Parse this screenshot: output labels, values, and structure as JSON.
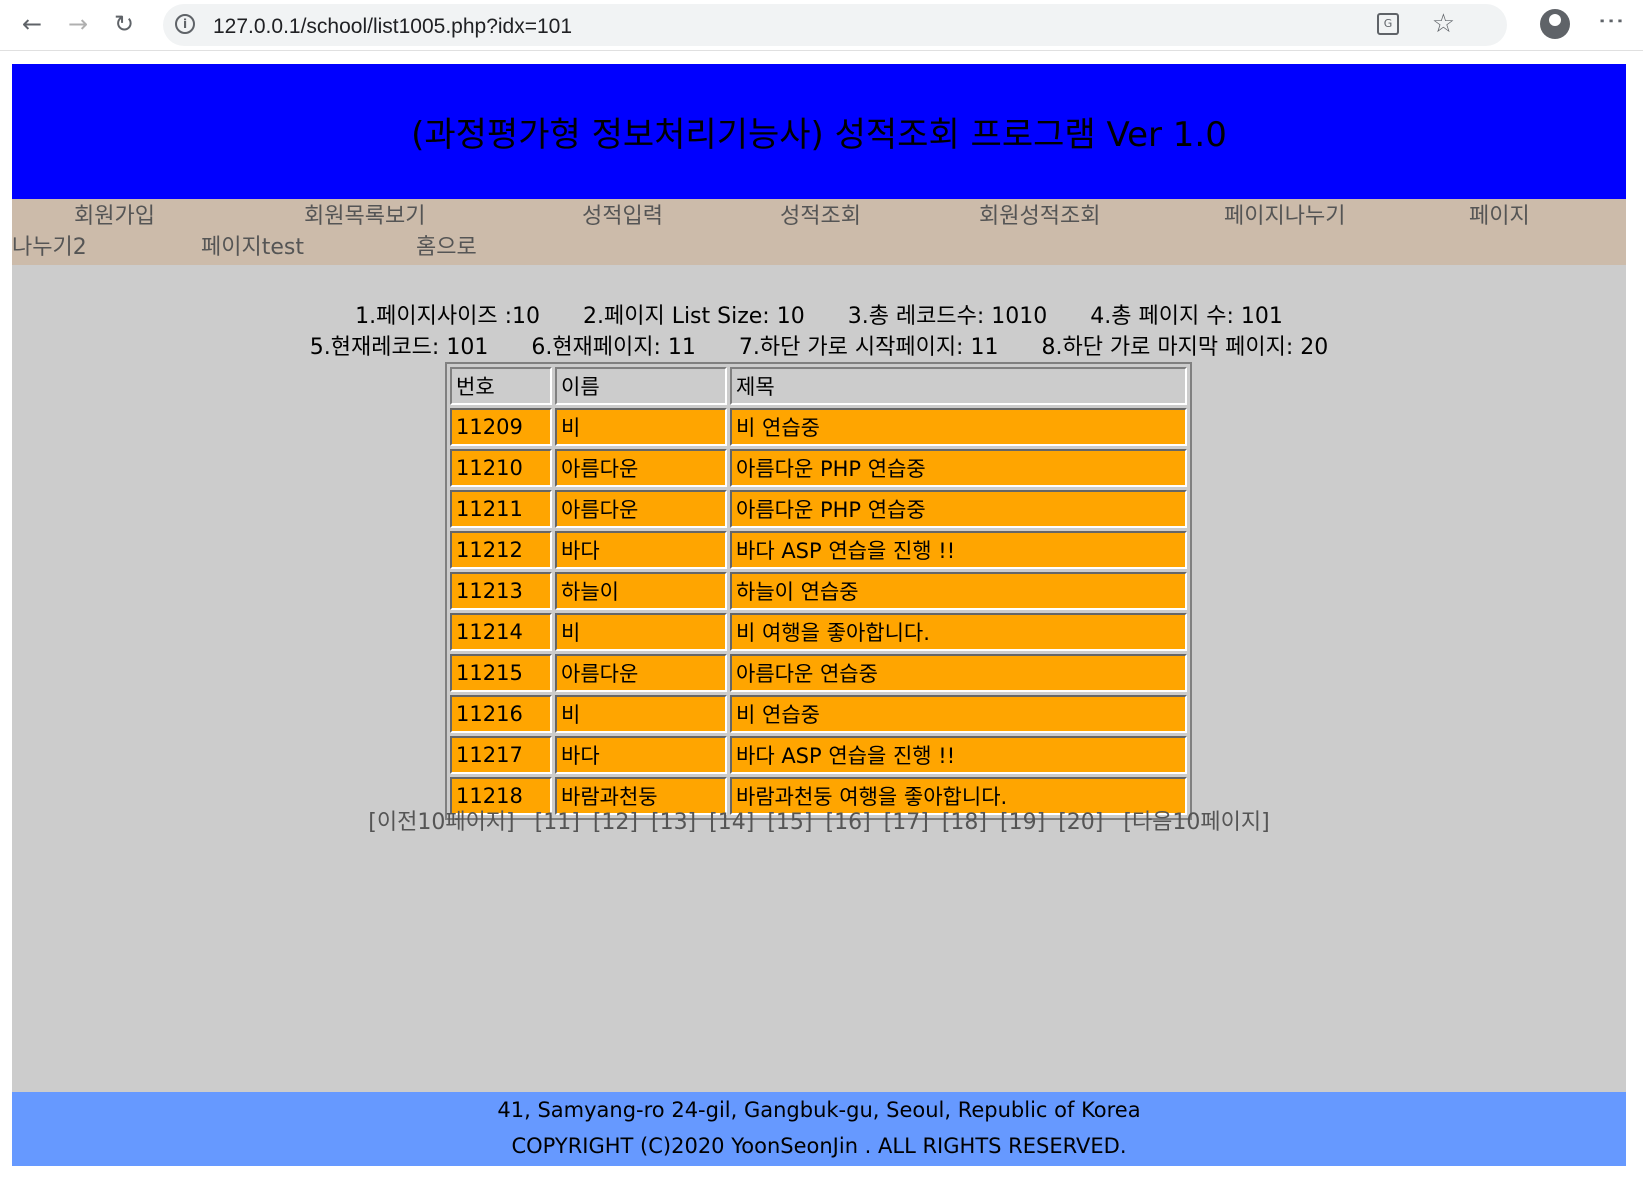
{
  "browser": {
    "url": "127.0.0.1/school/list1005.php?idx=101"
  },
  "header": {
    "title": "(과정평가형 정보처리기능사) 성적조회 프로그램 Ver 1.0"
  },
  "nav": {
    "items": [
      "회원가입",
      "회원목록보기",
      "성적입력",
      "성적조회",
      "회원성적조회",
      "페이지나누기",
      "페이지",
      "나누기2",
      "페이지test",
      "홈으로"
    ]
  },
  "info": {
    "line1": [
      "1.페이지사이즈 :10",
      "2.페이지 List Size: 10",
      "3.총 레코드수: 1010",
      "4.총 페이지 수: 101"
    ],
    "line2": [
      "5.현재레코드: 101",
      "6.현재페이지: 11",
      "7.하단 가로 시작페이지: 11",
      "8.하단 가로 마지막 페이지: 20"
    ]
  },
  "table": {
    "headers": [
      "번호",
      "이름",
      "제목"
    ],
    "rows": [
      [
        "11209",
        "비",
        "비 연습중"
      ],
      [
        "11210",
        "아름다운",
        "아름다운 PHP 연습중"
      ],
      [
        "11211",
        "아름다운",
        "아름다운 PHP 연습중"
      ],
      [
        "11212",
        "바다",
        "바다 ASP 연습을 진행 !!"
      ],
      [
        "11213",
        "하늘이",
        "하늘이 연습중"
      ],
      [
        "11214",
        "비",
        "비 여행을 좋아합니다."
      ],
      [
        "11215",
        "아름다운",
        "아름다운 연습중"
      ],
      [
        "11216",
        "비",
        "비 연습중"
      ],
      [
        "11217",
        "바다",
        "바다 ASP 연습을 진행 !!"
      ],
      [
        "11218",
        "바람과천둥",
        "바람과천둥 여행을 좋아합니다."
      ]
    ]
  },
  "pager": {
    "prev": "[이전10페이지]",
    "pages": [
      "[11]",
      "[12]",
      "[13]",
      "[14]",
      "[15]",
      "[16]",
      "[17]",
      "[18]",
      "[19]",
      "[20]"
    ],
    "next": "[다음10페이지]"
  },
  "footer": {
    "address": "41, Samyang-ro 24-gil, Gangbuk-gu, Seoul, Republic of Korea",
    "copyright": "COPYRIGHT (C)2020 YoonSeonJin . ALL RIGHTS RESERVED."
  },
  "colors": {
    "header_bg": "#0000ff",
    "nav_bg": "#ccbbaa",
    "page_bg": "#cccccc",
    "row_bg": "#ffa500",
    "footer_bg": "#6699ff"
  }
}
